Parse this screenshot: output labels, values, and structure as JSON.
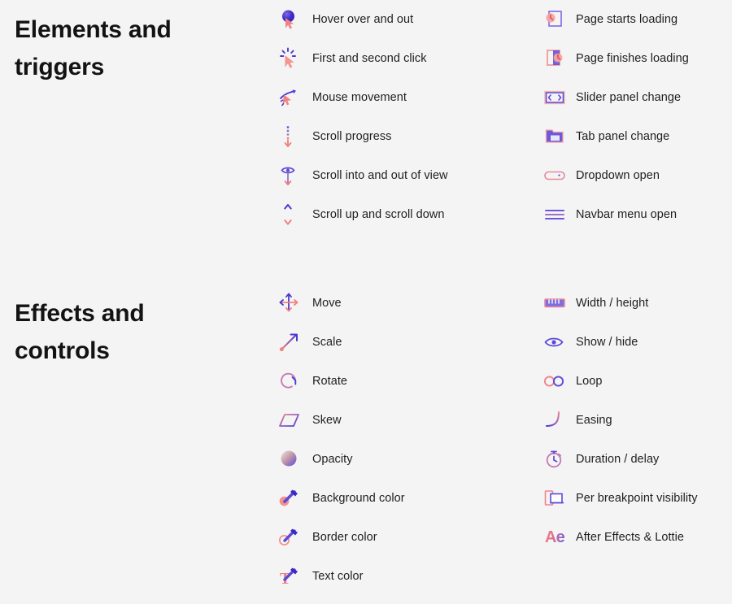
{
  "background_color": "#f4f4f4",
  "text_color": "#1f1f22",
  "heading_color": "#131313",
  "accent_colors": {
    "purple": "#4f3fd6",
    "indigo": "#5b4bdb",
    "pink": "#f4877f",
    "coral": "#f58a86",
    "violet": "#8a6ee0"
  },
  "sections": [
    {
      "id": "elements-and-triggers",
      "heading": "Elements and\ntriggers",
      "columns": [
        {
          "id": "elements-left",
          "items": [
            {
              "label": "Hover over and out",
              "icon": "hover-cursor-icon"
            },
            {
              "label": "First and second click",
              "icon": "click-cursor-icon"
            },
            {
              "label": "Mouse movement",
              "icon": "mouse-movement-icon"
            },
            {
              "label": "Scroll progress",
              "icon": "scroll-progress-icon"
            },
            {
              "label": "Scroll into and out of view",
              "icon": "scroll-into-view-icon"
            },
            {
              "label": "Scroll up and scroll down",
              "icon": "scroll-updown-icon"
            }
          ]
        },
        {
          "id": "elements-right",
          "items": [
            {
              "label": "Page starts loading",
              "icon": "page-start-loading-icon"
            },
            {
              "label": "Page finishes loading",
              "icon": "page-finish-loading-icon"
            },
            {
              "label": "Slider panel change",
              "icon": "slider-panel-icon"
            },
            {
              "label": "Tab panel change",
              "icon": "tab-panel-icon"
            },
            {
              "label": "Dropdown open",
              "icon": "dropdown-icon"
            },
            {
              "label": "Navbar menu open",
              "icon": "navbar-menu-icon"
            }
          ]
        }
      ]
    },
    {
      "id": "effects-and-controls",
      "heading": "Effects and\ncontrols",
      "columns": [
        {
          "id": "effects-left",
          "items": [
            {
              "label": "Move",
              "icon": "move-arrows-icon"
            },
            {
              "label": "Scale",
              "icon": "scale-arrow-icon"
            },
            {
              "label": "Rotate",
              "icon": "rotate-icon"
            },
            {
              "label": "Skew",
              "icon": "skew-parallelogram-icon"
            },
            {
              "label": "Opacity",
              "icon": "opacity-sphere-icon"
            },
            {
              "label": "Background color",
              "icon": "eyedropper-fill-icon"
            },
            {
              "label": "Border color",
              "icon": "eyedropper-border-icon"
            },
            {
              "label": "Text color",
              "icon": "eyedropper-text-icon"
            }
          ]
        },
        {
          "id": "effects-right",
          "items": [
            {
              "label": "Width / height",
              "icon": "ruler-icon"
            },
            {
              "label": "Show / hide",
              "icon": "eye-icon"
            },
            {
              "label": "Loop",
              "icon": "infinity-loop-icon"
            },
            {
              "label": "Easing",
              "icon": "easing-curve-icon"
            },
            {
              "label": "Duration / delay",
              "icon": "stopwatch-icon"
            },
            {
              "label": "Per breakpoint visibility",
              "icon": "breakpoint-devices-icon"
            },
            {
              "label": "After Effects & Lottie",
              "icon": "after-effects-logo-icon",
              "logo_text": "Ae"
            }
          ]
        }
      ]
    }
  ]
}
